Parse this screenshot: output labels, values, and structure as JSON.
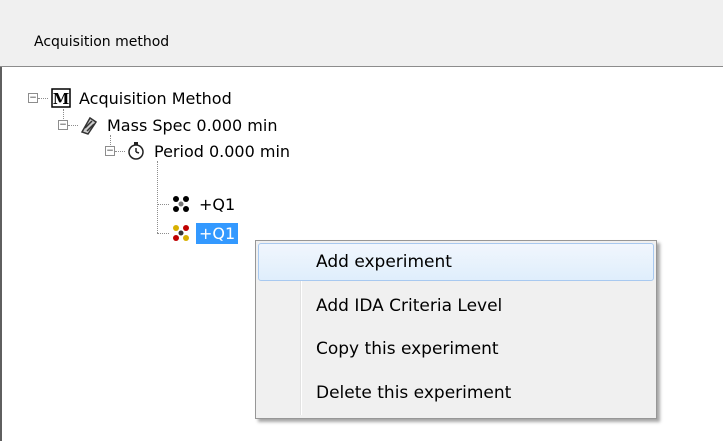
{
  "panel": {
    "title": "Acquisition method"
  },
  "tree": {
    "root": {
      "label": "Acquisition Method",
      "icon": "acquisition-method-icon",
      "expanded": true
    },
    "mass_spec": {
      "label": "Mass Spec  0.000 min",
      "icon": "mass-spec-icon",
      "expanded": true
    },
    "period": {
      "label": "Period  0.000 min",
      "icon": "period-clock-icon",
      "expanded": true
    },
    "experiments": [
      {
        "label": "+Q1",
        "icon": "experiment-icon",
        "selected": false
      },
      {
        "label": "+Q1",
        "icon": "experiment-icon",
        "selected": true
      }
    ]
  },
  "context_menu": {
    "items": [
      {
        "label": "Add experiment",
        "hovered": true
      },
      {
        "label": "Add IDA Criteria Level"
      },
      {
        "label": "Copy this experiment"
      },
      {
        "label": "Delete this experiment"
      }
    ]
  },
  "colors": {
    "selection": "#3399ff",
    "menu_bg": "#f0f0f0",
    "header_bg": "#f0f0f0"
  }
}
